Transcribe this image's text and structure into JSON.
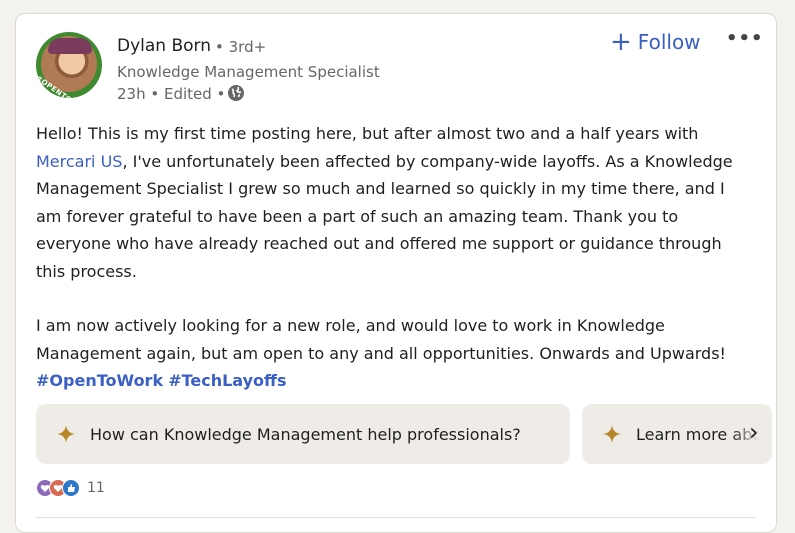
{
  "author": {
    "name": "Dylan Born",
    "degree": "• 3rd+",
    "headline": "Knowledge Management Specialist",
    "meta": "23h • Edited •",
    "avatar_badge": "#OPENTOWORK"
  },
  "actions": {
    "follow_label": "Follow",
    "follow_icon": "plus-icon",
    "more_label": "•••"
  },
  "post": {
    "p1_start": "Hello! This is my first time posting here, but after almost two and a half years with ",
    "p1_link": "Mercari US",
    "p1_end": ", I've unfortunately been affected by company-wide layoffs. As a Knowledge Management Specialist I grew so much and learned so quickly in my time there, and I am forever grateful to have been a part of such an amazing team. Thank you to everyone who have already reached out and offered me support or guidance through this process.",
    "p2_text": "I am now actively looking for a new role, and would love to work in Knowledge Management again, but am open to any and all opportunities. Onwards and Upwards! ",
    "hashtag1": "#OpenToWork",
    "hashtag2": "#TechLayoffs"
  },
  "suggestions": [
    {
      "label": "How can Knowledge Management help professionals?",
      "icon": "sparkle-icon"
    },
    {
      "label": "Learn more about",
      "icon": "sparkle-icon"
    }
  ],
  "reactions": {
    "count": "11",
    "icons": [
      "support-icon",
      "love-icon",
      "like-icon"
    ]
  },
  "colors": {
    "accent": "#3b5fc4",
    "sparkle": "#b8862b",
    "chip_bg": "#efece8"
  }
}
